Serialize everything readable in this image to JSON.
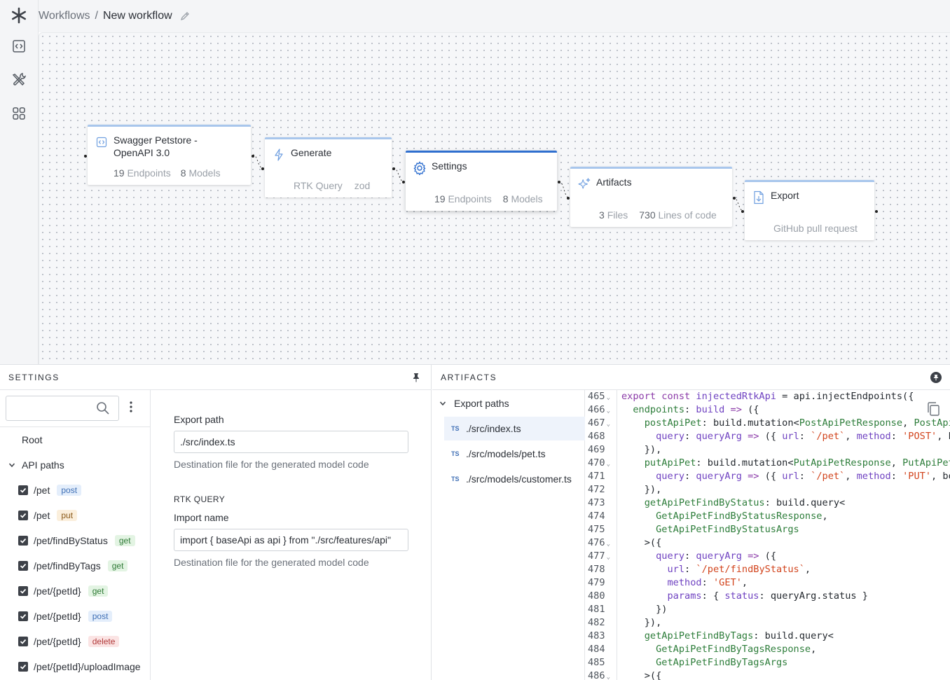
{
  "app": {
    "logo_icon": "asterisk-icon"
  },
  "rail": [
    {
      "icon": "code-file-icon"
    },
    {
      "icon": "tools-icon"
    },
    {
      "icon": "grid-icon"
    }
  ],
  "breadcrumb": {
    "root": "Workflows",
    "separator": "/",
    "current": "New workflow"
  },
  "nodes": {
    "source": {
      "title_line1": "Swagger Petstore -",
      "title_line2": "OpenAPI 3.0",
      "stat1_value": "19",
      "stat1_label": "Endpoints",
      "stat2_value": "8",
      "stat2_label": "Models"
    },
    "generate": {
      "title": "Generate",
      "tag1": "RTK Query",
      "tag2": "zod"
    },
    "settings": {
      "title": "Settings",
      "stat1_value": "19",
      "stat1_label": "Endpoints",
      "stat2_value": "8",
      "stat2_label": "Models"
    },
    "artifacts": {
      "title": "Artifacts",
      "stat1_value": "3",
      "stat1_label": "Files",
      "stat2_value": "730",
      "stat2_label": "Lines of code"
    },
    "export": {
      "title": "Export",
      "subtitle": "GitHub pull request"
    }
  },
  "settings_panel": {
    "title": "SETTINGS",
    "search_placeholder": "",
    "tree": {
      "root": "Root",
      "group": "API paths",
      "paths": [
        {
          "path": "/pet",
          "method": "post"
        },
        {
          "path": "/pet",
          "method": "put"
        },
        {
          "path": "/pet/findByStatus",
          "method": "get"
        },
        {
          "path": "/pet/findByTags",
          "method": "get"
        },
        {
          "path": "/pet/{petId}",
          "method": "get"
        },
        {
          "path": "/pet/{petId}",
          "method": "post"
        },
        {
          "path": "/pet/{petId}",
          "method": "delete"
        },
        {
          "path": "/pet/{petId}/uploadImage",
          "method": ""
        }
      ]
    },
    "form": {
      "export_path_label": "Export path",
      "export_path_value": "./src/index.ts",
      "export_path_help": "Destination file for the generated model code",
      "section": "RTK QUERY",
      "import_name_label": "Import name",
      "import_name_value": "import { baseApi as api } from \"./src/features/api\"",
      "import_name_help": "Destination file for the generated model code"
    }
  },
  "artifacts_panel": {
    "title": "ARTIFACTS",
    "group": "Export paths",
    "files": [
      {
        "badge": "TS",
        "path": "./src/index.ts",
        "selected": true
      },
      {
        "badge": "TS",
        "path": "./src/models/pet.ts",
        "selected": false
      },
      {
        "badge": "TS",
        "path": "./src/models/customer.ts",
        "selected": false
      }
    ],
    "code": {
      "line_numbers": [
        "465",
        "466",
        "467",
        "468",
        "469",
        "470",
        "471",
        "472",
        "473",
        "474",
        "475",
        "476",
        "477",
        "478",
        "479",
        "480",
        "481",
        "482",
        "483",
        "484",
        "485",
        "486"
      ],
      "folds": [
        true,
        true,
        true,
        false,
        false,
        true,
        false,
        false,
        false,
        false,
        false,
        true,
        true,
        false,
        false,
        false,
        false,
        false,
        false,
        false,
        false,
        true
      ]
    }
  },
  "colors": {
    "accent": "#2f6fcf",
    "node_top": "#a8c6ec",
    "keyword": "#8b3aa8",
    "property": "#2d7d3a",
    "string": "#d2451e"
  }
}
